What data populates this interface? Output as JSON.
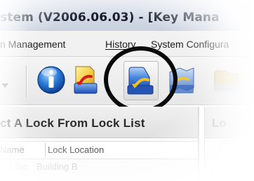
{
  "window": {
    "title": "stem  (V2006.06.03) - [Key Mana"
  },
  "menu": {
    "items": [
      {
        "label": "n Management"
      },
      {
        "label": "History"
      },
      {
        "label": "System Configura"
      }
    ]
  },
  "toolbar": {
    "buttons": [
      {
        "icon": "info-icon"
      },
      {
        "icon": "lock-document-red-arrow-icon"
      },
      {
        "icon": "folder-yellow-arrow-icon",
        "state": "pressed"
      },
      {
        "icon": "folder-open-yellow-arrow-icon"
      },
      {
        "icon": "folder-icon"
      }
    ]
  },
  "lock_list": {
    "title": "ct A Lock From Lock List",
    "columns": [
      "Name",
      "Lock Location"
    ],
    "rows": [
      {
        "name": "l Stc",
        "location": "Building B"
      }
    ]
  },
  "right_panel": {
    "title": "Lo"
  }
}
